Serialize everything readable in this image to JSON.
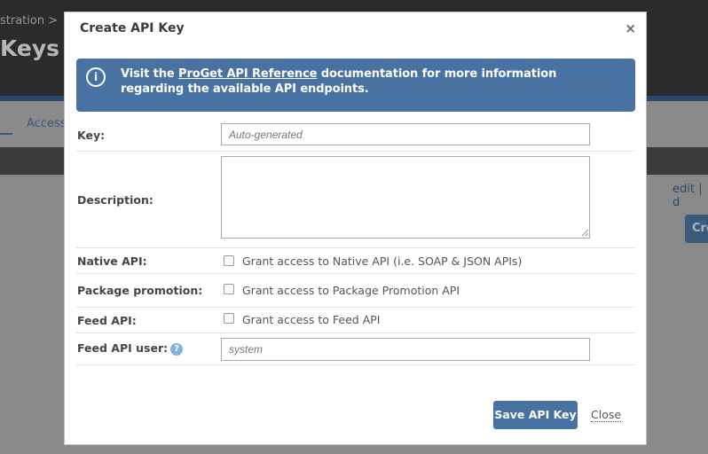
{
  "background": {
    "breadcrumb": "stration >",
    "title": "Keys",
    "tab_label": "Access",
    "edit_link": "edit | d",
    "create_button": "Cre"
  },
  "modal": {
    "title": "Create API Key",
    "close_glyph": "×",
    "info": {
      "icon": "i",
      "text_before": "Visit the ",
      "link": "ProGet API Reference",
      "text_after": " documentation for more information regarding the available API endpoints."
    },
    "fields": {
      "key": {
        "label": "Key:",
        "placeholder": "Auto-generated"
      },
      "description": {
        "label": "Description:",
        "value": ""
      },
      "native_api": {
        "label": "Native API:",
        "checkbox_text": "Grant access to Native API (i.e. SOAP & JSON APIs)",
        "checked": false
      },
      "package_promotion": {
        "label": "Package promotion:",
        "checkbox_text": "Grant access to Package Promotion API",
        "checked": false
      },
      "feed_api": {
        "label": "Feed API:",
        "checkbox_text": "Grant access to Feed API",
        "checked": false
      },
      "feed_api_user": {
        "label": "Feed API user:",
        "help": "?",
        "placeholder": "system"
      }
    },
    "buttons": {
      "save": "Save API Key",
      "close": "Close"
    }
  },
  "colors": {
    "accent": "#4872a1",
    "overlay": "#8a8a8a",
    "help_icon": "#7fb1dc"
  },
  "icons": [
    "info-icon",
    "close-icon",
    "help-icon"
  ]
}
